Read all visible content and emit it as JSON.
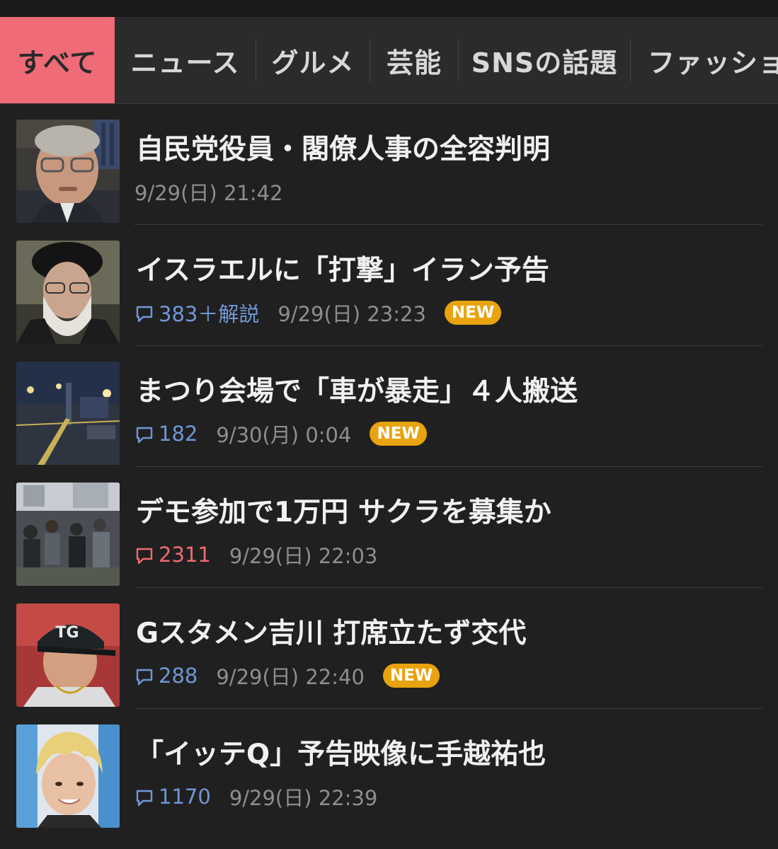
{
  "tabs": [
    {
      "label": "すべて",
      "active": true
    },
    {
      "label": "ニュース",
      "active": false
    },
    {
      "label": "グルメ",
      "active": false
    },
    {
      "label": "芸能",
      "active": false
    },
    {
      "label": "SNSの話題",
      "active": false
    },
    {
      "label": "ファッショ",
      "active": false
    }
  ],
  "articles": [
    {
      "title": "自民党役員・閣僚人事の全容判明",
      "comments": "",
      "date": "9/29(日) 21:42",
      "badge": "",
      "thumb_icon": "politician-photo"
    },
    {
      "title": "イスラエルに「打撃」イラン予告",
      "comments": "383＋解説",
      "date": "9/29(日) 23:23",
      "badge": "NEW",
      "thumb_icon": "leader-photo"
    },
    {
      "title": "まつり会場で「車が暴走」４人搬送",
      "comments": "182",
      "date": "9/30(月) 0:04",
      "badge": "NEW",
      "thumb_icon": "night-scene-photo"
    },
    {
      "title": "デモ参加で1万円 サクラを募集か",
      "comments": "2311",
      "comments_hot": true,
      "date": "9/29(日) 22:03",
      "badge": "",
      "thumb_icon": "crowd-photo"
    },
    {
      "title": "Gスタメン吉川 打席立たず交代",
      "comments": "288",
      "date": "9/29(日) 22:40",
      "badge": "NEW",
      "thumb_icon": "baseball-player-photo"
    },
    {
      "title": "「イッテQ」予告映像に手越祐也",
      "comments": "1170",
      "date": "9/29(日) 22:39",
      "badge": "",
      "thumb_icon": "celebrity-photo"
    }
  ],
  "colors": {
    "background": "#202020",
    "tabbar": "#2b2b2b",
    "active_tab": "#f06b78",
    "comment_blue": "#6f97d6",
    "comment_hot": "#ee6a70",
    "badge": "#e8a30f"
  }
}
